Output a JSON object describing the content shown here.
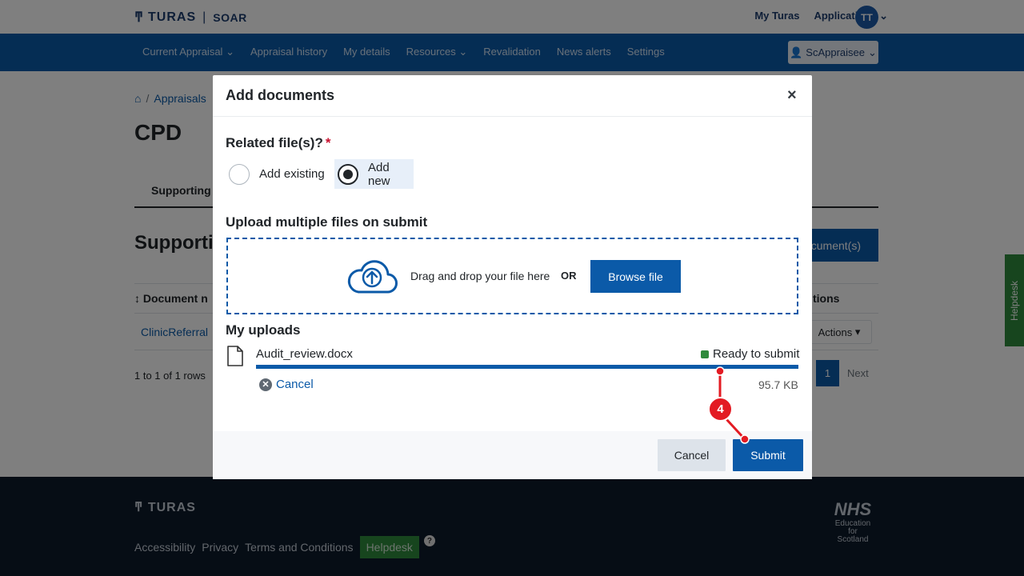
{
  "topbar": {
    "logo_text": "TURAS",
    "product": "SOAR",
    "links": [
      "My Turas",
      "Applications"
    ],
    "avatar_initials": "TT"
  },
  "nav": {
    "items": [
      "Current Appraisal",
      "Appraisal history",
      "My details",
      "Resources",
      "Revalidation",
      "News alerts",
      "Settings"
    ],
    "user": "ScAppraisee"
  },
  "page": {
    "breadcrumb": "Appraisals",
    "title": "CPD",
    "tab": "Supporting",
    "section_title": "Supporti",
    "add_button": "cument(s)",
    "table_col_1": "Document n",
    "table_col_2": "tions",
    "row_link": "ClinicReferral",
    "row_actions": "Actions",
    "rows_info": "1 to 1 of 1 rows",
    "page_num": "1",
    "next": "Next"
  },
  "helpdesk_side": "Helpdesk",
  "footer": {
    "logo": "TURAS",
    "links": [
      "Accessibility",
      "Privacy",
      "Terms and Conditions"
    ],
    "helpdesk": "Helpdesk",
    "help_q": "?",
    "nhs": "NHS",
    "nhs_sub": [
      "Education",
      "for",
      "Scotland"
    ]
  },
  "modal": {
    "title": "Add documents",
    "close": "×",
    "related_label": "Related file(s)?",
    "required_mark": "*",
    "radio_existing": "Add existing",
    "radio_new": "Add new",
    "upload_label": "Upload multiple files on submit",
    "dropzone_text": "Drag and drop your file here",
    "dropzone_or": "OR",
    "browse_button": "Browse file",
    "my_uploads": "My uploads",
    "file": {
      "name": "Audit_review.docx",
      "status": "Ready to submit",
      "progress_percent": 100,
      "cancel": "Cancel",
      "size": "95.7 KB"
    },
    "cancel_button": "Cancel",
    "submit_button": "Submit"
  },
  "annotation": {
    "step": "4",
    "color": "#e31b23"
  },
  "colors": {
    "primary": "#0b5aa8",
    "navy": "#1d3d6e",
    "success": "#2f8a3c",
    "footer_bg": "#0d1a2b"
  }
}
